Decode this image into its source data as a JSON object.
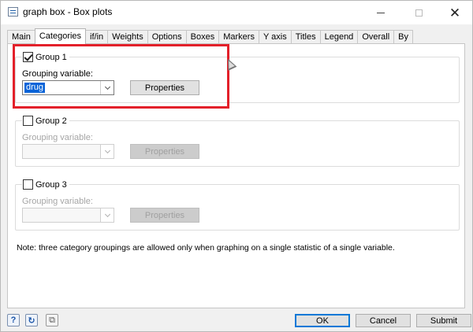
{
  "window": {
    "title": "graph box - Box plots",
    "close_glyph": "✕"
  },
  "tabs": [
    {
      "label": "Main"
    },
    {
      "label": "Categories",
      "active": true
    },
    {
      "label": "if/in"
    },
    {
      "label": "Weights"
    },
    {
      "label": "Options"
    },
    {
      "label": "Boxes"
    },
    {
      "label": "Markers"
    },
    {
      "label": "Y axis"
    },
    {
      "label": "Titles"
    },
    {
      "label": "Legend"
    },
    {
      "label": "Overall"
    },
    {
      "label": "By"
    }
  ],
  "groups": [
    {
      "title": "Group 1",
      "checked": true,
      "enabled": true,
      "field_label": "Grouping variable:",
      "value": "drug",
      "properties_label": "Properties"
    },
    {
      "title": "Group 2",
      "checked": false,
      "enabled": false,
      "field_label": "Grouping variable:",
      "value": "",
      "properties_label": "Properties"
    },
    {
      "title": "Group 3",
      "checked": false,
      "enabled": false,
      "field_label": "Grouping variable:",
      "value": "",
      "properties_label": "Properties"
    }
  ],
  "note": "Note: three category groupings are allowed only when graphing on a single statistic of a single variable.",
  "footer": {
    "help_icon_glyph": "?",
    "reset_icon_glyph": "↻",
    "copy_icon_glyph": "⧉",
    "ok_label": "OK",
    "cancel_label": "Cancel",
    "submit_label": "Submit"
  },
  "colors": {
    "highlight": "#e3202a",
    "selection": "#0a64d8",
    "default_button_border": "#0078d7"
  }
}
